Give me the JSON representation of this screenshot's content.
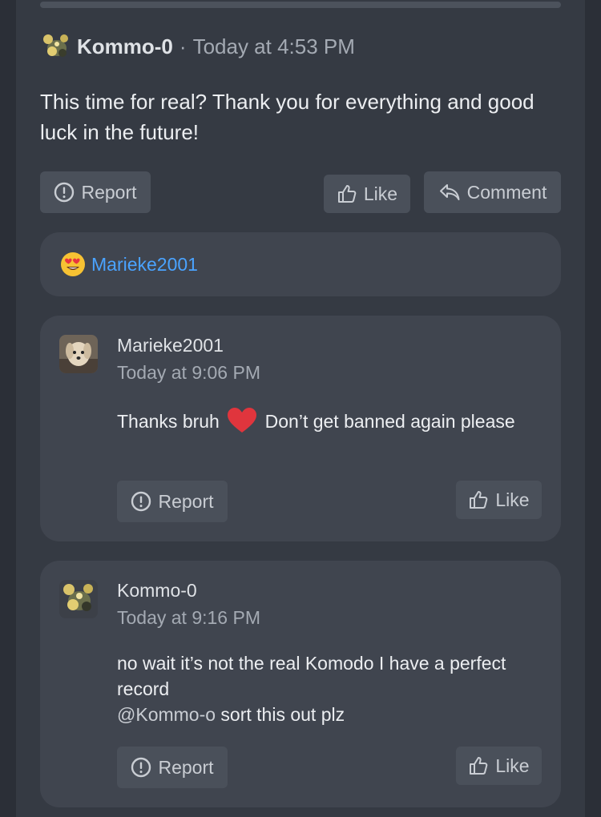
{
  "post": {
    "author": "Kommo-0",
    "separator": "·",
    "timestamp": "Today at 4:53 PM",
    "body": "This time for real? Thank you for everything and good luck in the future!",
    "actions": {
      "report_label": "Report",
      "like_label": "Like",
      "comment_label": "Comment"
    }
  },
  "reactions": {
    "emoji_icon": "heart-eyes-emoji-icon",
    "user": "Marieke2001"
  },
  "comments": [
    {
      "author": "Marieke2001",
      "timestamp": "Today at 9:06 PM",
      "text_before": "Thanks bruh",
      "emoji_icon": "red-heart-emoji-icon",
      "text_after": "Don’t get banned again please",
      "report_label": "Report",
      "like_label": "Like"
    },
    {
      "author": "Kommo-0",
      "timestamp": "Today at 9:16 PM",
      "line1": "no wait it’s not the real Komodo I have a perfect record",
      "mention": "@Kommo-o",
      "line2_rest": " sort this out plz",
      "report_label": "Report",
      "like_label": "Like"
    }
  ],
  "colors": {
    "background": "#2b2f37",
    "panel": "#353a43",
    "card": "#40454f",
    "button": "#4a505a",
    "link": "#4aa3ff",
    "heart": "#e0353d"
  }
}
